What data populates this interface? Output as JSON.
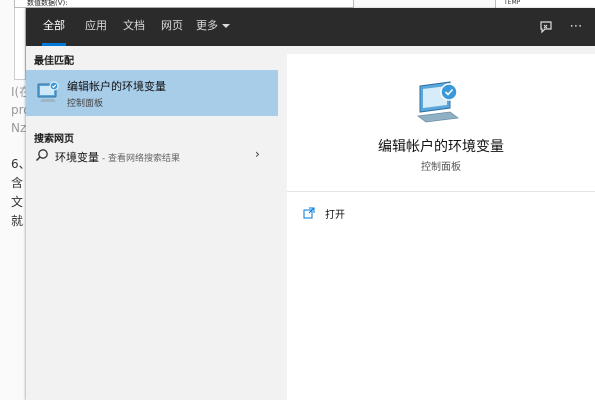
{
  "background": {
    "dialog_top_text": "数值数据(V):",
    "dialog_right_text": "TEMP",
    "lines": [
      "I(在",
      "pro",
      "Nz",
      "6、",
      "含",
      "文",
      "就"
    ]
  },
  "tabs": [
    {
      "label": "全部",
      "active": true
    },
    {
      "label": "应用",
      "active": false
    },
    {
      "label": "文档",
      "active": false
    },
    {
      "label": "网页",
      "active": false
    },
    {
      "label": "更多",
      "active": false
    }
  ],
  "top_icons": [
    "feedback-icon",
    "more-options-icon"
  ],
  "top_icon_glyphs": {
    "more": "⋯"
  },
  "results": {
    "best_match_heading": "最佳匹配",
    "best_match": {
      "title": "编辑帐户的环境变量",
      "subtitle": "控制面板",
      "icon": "control-panel-monitor-icon"
    },
    "web_heading": "搜索网页",
    "web_item": {
      "query": "环境变量",
      "hint": " - 查看网络搜索结果",
      "icon": "search-icon",
      "chevron": "›"
    }
  },
  "detail": {
    "title": "编辑帐户的环境变量",
    "subtitle": "控制面板",
    "actions": [
      {
        "label": "打开",
        "icon": "open-icon"
      }
    ]
  },
  "colors": {
    "topbar": "#2b2b2b",
    "accent": "#0078d7",
    "selected_item": "#a8cde9"
  }
}
